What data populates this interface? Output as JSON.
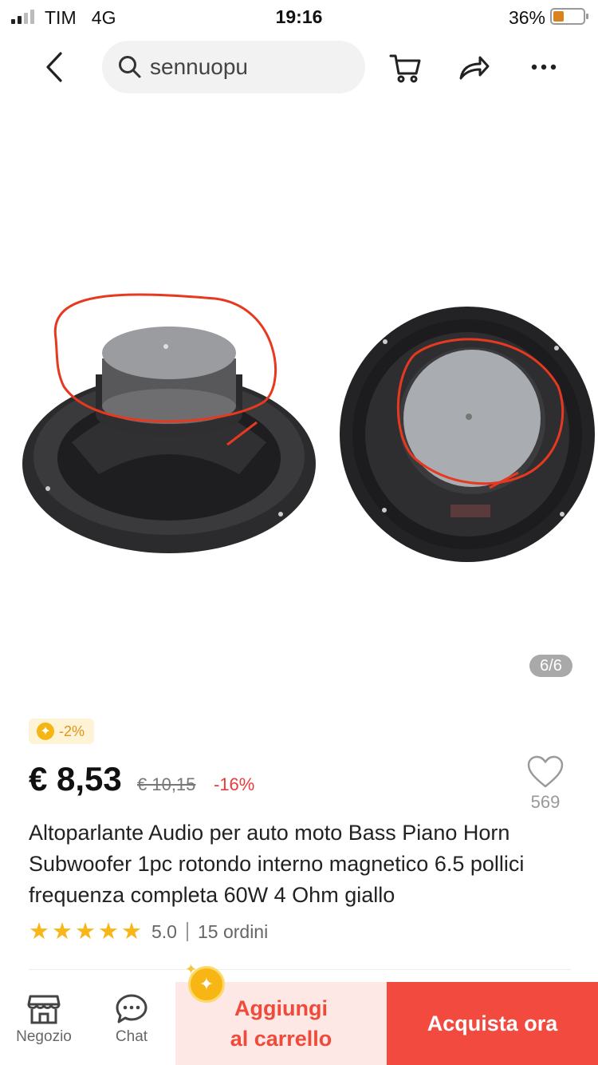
{
  "status_bar": {
    "carrier": "TIM",
    "network": "4G",
    "time": "19:16",
    "battery_percent": "36%",
    "battery_level": 0.36
  },
  "nav": {
    "search_text": "sennuopu",
    "icons": [
      "back-chevron-icon",
      "search-icon",
      "cart-icon",
      "share-icon",
      "more-icon"
    ]
  },
  "gallery": {
    "page_indicator": "6/6"
  },
  "product": {
    "coin_discount": "-2%",
    "price": "€ 8,53",
    "old_price": "€ 10,15",
    "discount": "-16%",
    "wishlist_count": "569",
    "title": "Altoparlante Audio per auto moto Bass Piano Horn Subwoofer 1pc rotondo interno magnetico 6.5 pollici frequenza completa 60W 4 Ohm giallo",
    "rating": "5.0",
    "stars": 5,
    "orders": "15 ordini"
  },
  "bottom_bar": {
    "store_label": "Negozio",
    "chat_label": "Chat",
    "add_to_cart_label": "Aggiungi\nal carrello",
    "buy_now_label": "Acquista ora"
  },
  "colors": {
    "accent_red": "#f34a3f",
    "star_yellow": "#f7b718",
    "cart_bg": "#fde8e5"
  }
}
